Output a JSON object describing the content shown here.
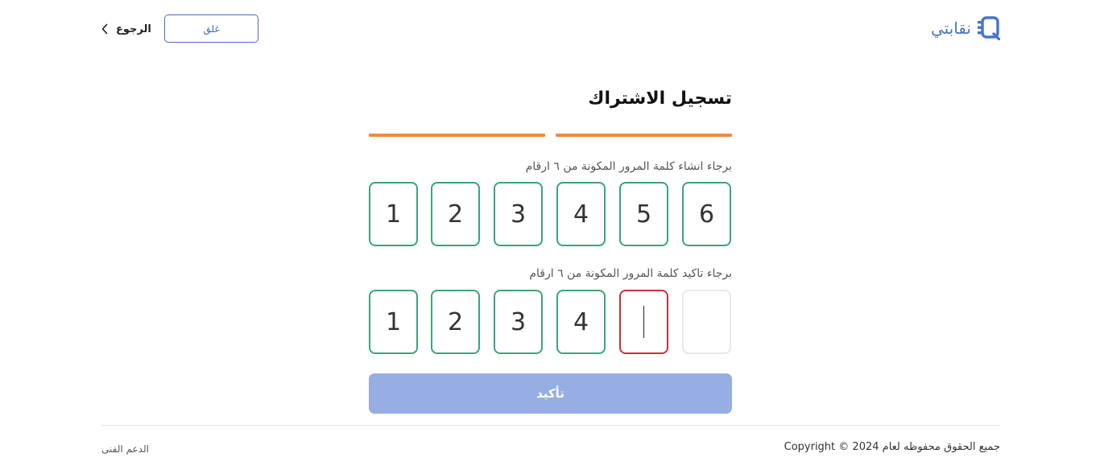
{
  "header": {
    "brand_name": "نقابتي",
    "close_label": "غلق",
    "back_label": "الرجوع"
  },
  "form": {
    "title": "تسجيل الاشتراك",
    "steps_total": 2,
    "steps_completed": 2,
    "progress_color": "#f08a3c",
    "create_label": "برجاء انشاء كلمة المرور المكونة من ٦ ارقام",
    "create_pin": [
      "6",
      "5",
      "4",
      "3",
      "2",
      "1"
    ],
    "confirm_label": "برجاء تاكيد كلمة المرور المكونة من ٦ ارقام",
    "confirm_pin": [
      "",
      "",
      "4",
      "3",
      "2",
      "1"
    ],
    "confirm_button_label": "تأكيد"
  },
  "colors": {
    "accent": "#4a6bc0",
    "pin_ok_border": "#3aa57a",
    "pin_error_border": "#c9303b",
    "button_disabled_bg": "#96aee3"
  },
  "icons": {
    "brand": "app-logo-icon",
    "back": "chevron-right-icon"
  },
  "footer": {
    "copyright": "جميع الحقوق محفوظه لعام 2024 © Copyright",
    "support_label": "الدعم الفنى"
  }
}
